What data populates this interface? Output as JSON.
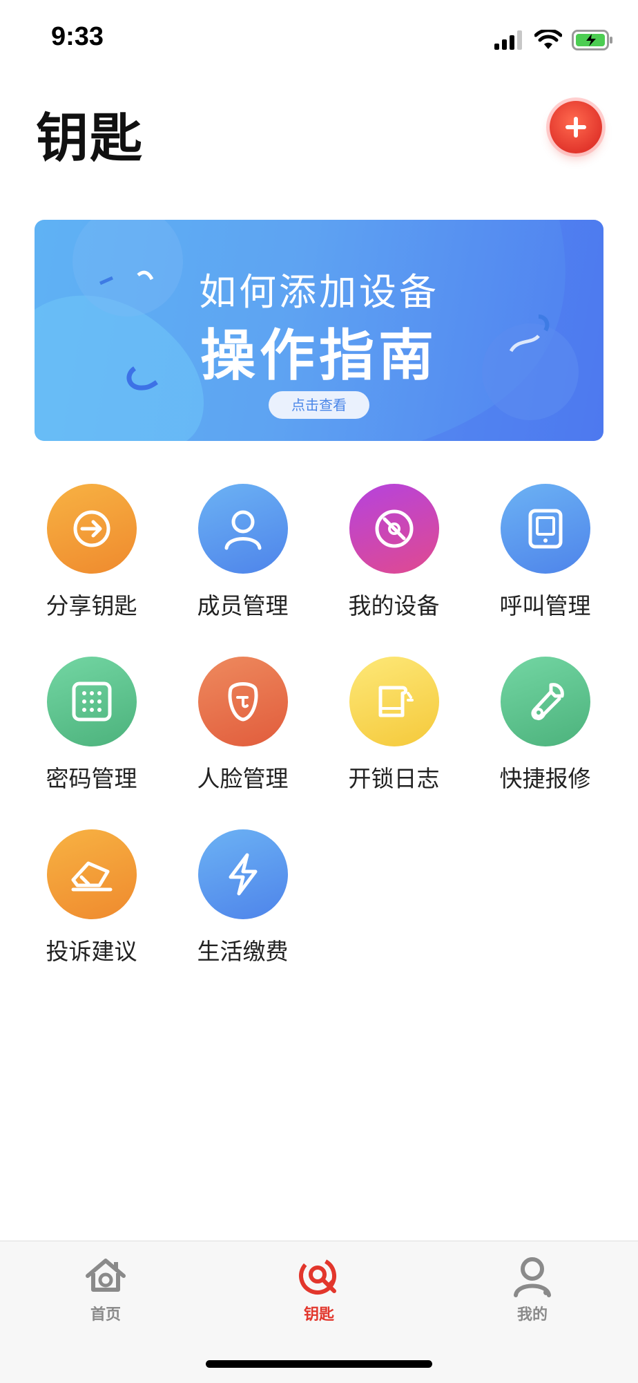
{
  "status_bar": {
    "time": "9:33"
  },
  "header": {
    "title": "钥匙"
  },
  "banner": {
    "line1": "如何添加设备",
    "line2": "操作指南",
    "button_label": "点击查看"
  },
  "grid": [
    {
      "label": "分享钥匙",
      "icon": "share-arrow-icon",
      "color_from": "#f7b243",
      "color_to": "#ef8a2e"
    },
    {
      "label": "成员管理",
      "icon": "person-icon",
      "color_from": "#6cb2f4",
      "color_to": "#4e84ea"
    },
    {
      "label": "我的设备",
      "icon": "disc-icon",
      "color_from": "#b543de",
      "color_to": "#e04a8f"
    },
    {
      "label": "呼叫管理",
      "icon": "tablet-icon",
      "color_from": "#6cb2f4",
      "color_to": "#4e84ea"
    },
    {
      "label": "密码管理",
      "icon": "keypad-icon",
      "color_from": "#73d6a3",
      "color_to": "#4cb27c"
    },
    {
      "label": "人脸管理",
      "icon": "face-icon",
      "color_from": "#ee8a5e",
      "color_to": "#e15c3c"
    },
    {
      "label": "开锁日志",
      "icon": "log-book-icon",
      "color_from": "#fde878",
      "color_to": "#f5c93b"
    },
    {
      "label": "快捷报修",
      "icon": "wrench-icon",
      "color_from": "#73d6a3",
      "color_to": "#4cb27c"
    },
    {
      "label": "投诉建议",
      "icon": "eraser-icon",
      "color_from": "#f7b243",
      "color_to": "#ef8a2e"
    },
    {
      "label": "生活缴费",
      "icon": "lightning-icon",
      "color_from": "#6cb2f4",
      "color_to": "#4e84ea"
    }
  ],
  "tab_bar": {
    "items": [
      {
        "label": "首页",
        "icon": "home-icon",
        "active": false
      },
      {
        "label": "钥匙",
        "icon": "key-icon",
        "active": true
      },
      {
        "label": "我的",
        "icon": "profile-icon",
        "active": false
      }
    ]
  },
  "colors": {
    "accent": "#e2362c",
    "inactive": "#8a8a8a"
  }
}
